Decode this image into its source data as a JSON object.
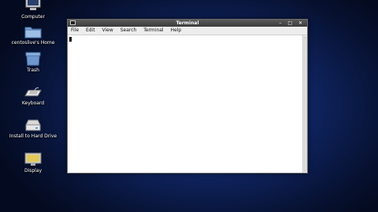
{
  "desktop": {
    "icons": [
      {
        "label": "Computer",
        "icon": "computer-icon"
      },
      {
        "label": "centoslive's Home",
        "icon": "home-folder-icon"
      },
      {
        "label": "Trash",
        "icon": "trash-icon"
      },
      {
        "label": "Keyboard",
        "icon": "keyboard-icon"
      },
      {
        "label": "Install to Hard Drive",
        "icon": "install-drive-icon"
      },
      {
        "label": "Display",
        "icon": "display-icon"
      }
    ]
  },
  "window": {
    "title": "Terminal",
    "controls": "– □ ✕",
    "menu": [
      "File",
      "Edit",
      "View",
      "Search",
      "Terminal",
      "Help"
    ]
  }
}
